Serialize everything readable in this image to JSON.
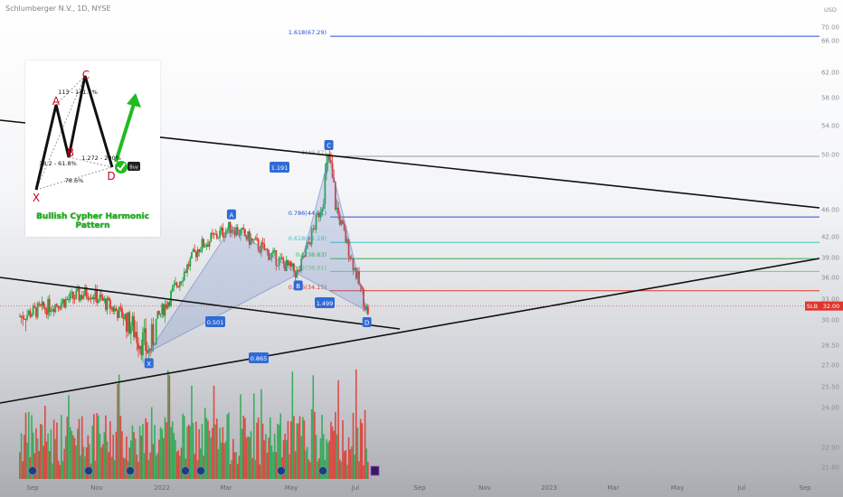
{
  "header": {
    "symbol": "Schlumberger N.V., 1D, NYSE"
  },
  "price_axis": {
    "currency": "USD",
    "last_price_symbol": "SLB",
    "last_price_value": "32.00"
  },
  "pattern_card": {
    "caption": "Bullish Cypher Harmonic Pattern",
    "points": [
      "X",
      "A",
      "B",
      "C",
      "D"
    ],
    "ratio_xc": "113 - 141.4%",
    "ratio_xb": "38.2 - 61.8%",
    "ratio_bd": "1.272 - 200%",
    "ratio_xd": "78.6%",
    "buy_tag": "Buy",
    "colors": {
      "legs": "#111111",
      "points": "#d0021b",
      "arrow": "#22bb22"
    }
  },
  "colors": {
    "up_candle": "#22a84a",
    "down_candle": "#e0352b",
    "pattern_fill": "#6d87c9",
    "point_label": "#2f6bd8",
    "trendline": "#111111"
  },
  "chart_data": {
    "type": "candlestick",
    "instrument": "Schlumberger N.V., 1D, NYSE",
    "ylim": [
      21.8,
      70
    ],
    "y_tick_labels": [
      "70.00",
      "66.00",
      "62.00",
      "58.00",
      "54.00",
      "50.00",
      "46.00",
      "42.00",
      "39.00",
      "36.00",
      "33.00",
      "30.00",
      "28.50",
      "27.00",
      "25.50",
      "24.00",
      "22.90",
      "21.80"
    ],
    "x_tick_labels": [
      "Sep",
      "Nov",
      "2022",
      "Mar",
      "May",
      "Jul",
      "Sep",
      "Nov",
      "2023",
      "Mar",
      "May",
      "Jul",
      "Sep"
    ],
    "last_price": 32.0,
    "harmonic_points": [
      {
        "label": "X",
        "date": "2021-12-20",
        "price": 28.0
      },
      {
        "label": "A",
        "date": "2022-03-08",
        "price": 43.5
      },
      {
        "label": "B",
        "date": "2022-05-10",
        "price": 36.5
      },
      {
        "label": "C",
        "date": "2022-06-08",
        "price": 49.8
      },
      {
        "label": "D",
        "date": "2022-07-14",
        "price": 31.3
      }
    ],
    "harmonic_ratios": [
      {
        "leg": "XA-AB",
        "text": "0.501"
      },
      {
        "leg": "AB-BC",
        "text": "1.191"
      },
      {
        "leg": "BC-CD",
        "text": "1.499"
      },
      {
        "leg": "XC-XD",
        "text": "0.865"
      }
    ],
    "fib_levels": [
      {
        "ratio": "1.618",
        "price": 67.29,
        "label": "1.618(67.29)",
        "color": "#2a4bd7"
      },
      {
        "ratio": "1",
        "price": 49.87,
        "label": "1(49.87)",
        "color": "#9a9a9a"
      },
      {
        "ratio": "0.786",
        "price": 44.91,
        "label": "0.786(44.91)",
        "color": "#2a4bd7"
      },
      {
        "ratio": "0.618",
        "price": 41.19,
        "label": "0.618(41.19)",
        "color": "#35c7c7"
      },
      {
        "ratio": "0.5",
        "price": 38.83,
        "label": "0.5(38.83)",
        "color": "#35b04a"
      },
      {
        "ratio": "0.382",
        "price": 36.91,
        "label": "0.382(36.91)",
        "color": "#7dc67d"
      },
      {
        "ratio": "0.236",
        "price": 34.15,
        "label": "0.236(34.15)",
        "color": "#e0352b"
      }
    ],
    "grid": false
  }
}
